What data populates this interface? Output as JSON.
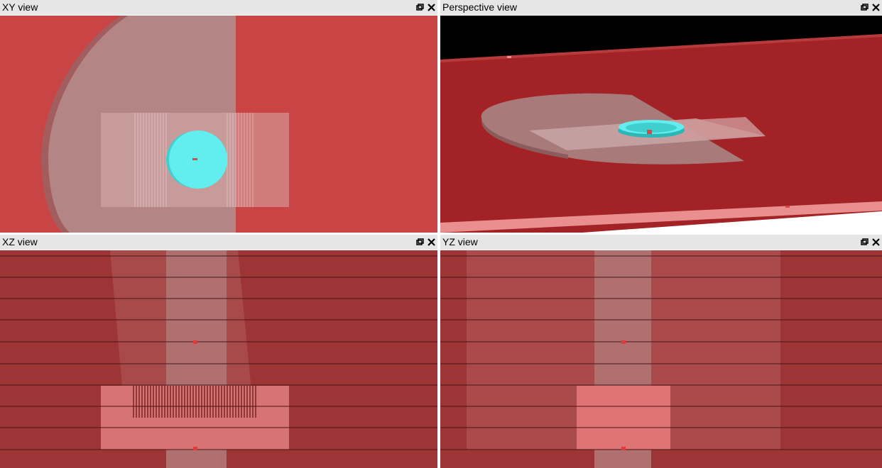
{
  "views": [
    {
      "id": "xy",
      "title": "XY view"
    },
    {
      "id": "perspective",
      "title": "Perspective view"
    },
    {
      "id": "xz",
      "title": "XZ view"
    },
    {
      "id": "yz",
      "title": "YZ view"
    }
  ],
  "colors": {
    "titlebar_bg": "#e6e6e6",
    "background_red": "#c94444",
    "dark_red": "#9d3536",
    "cyan": "#62eeee",
    "translucent_gray": "#b08a8a",
    "light_pink": "#e07575"
  },
  "icons": {
    "restore": "restore-icon",
    "close": "close-icon"
  }
}
